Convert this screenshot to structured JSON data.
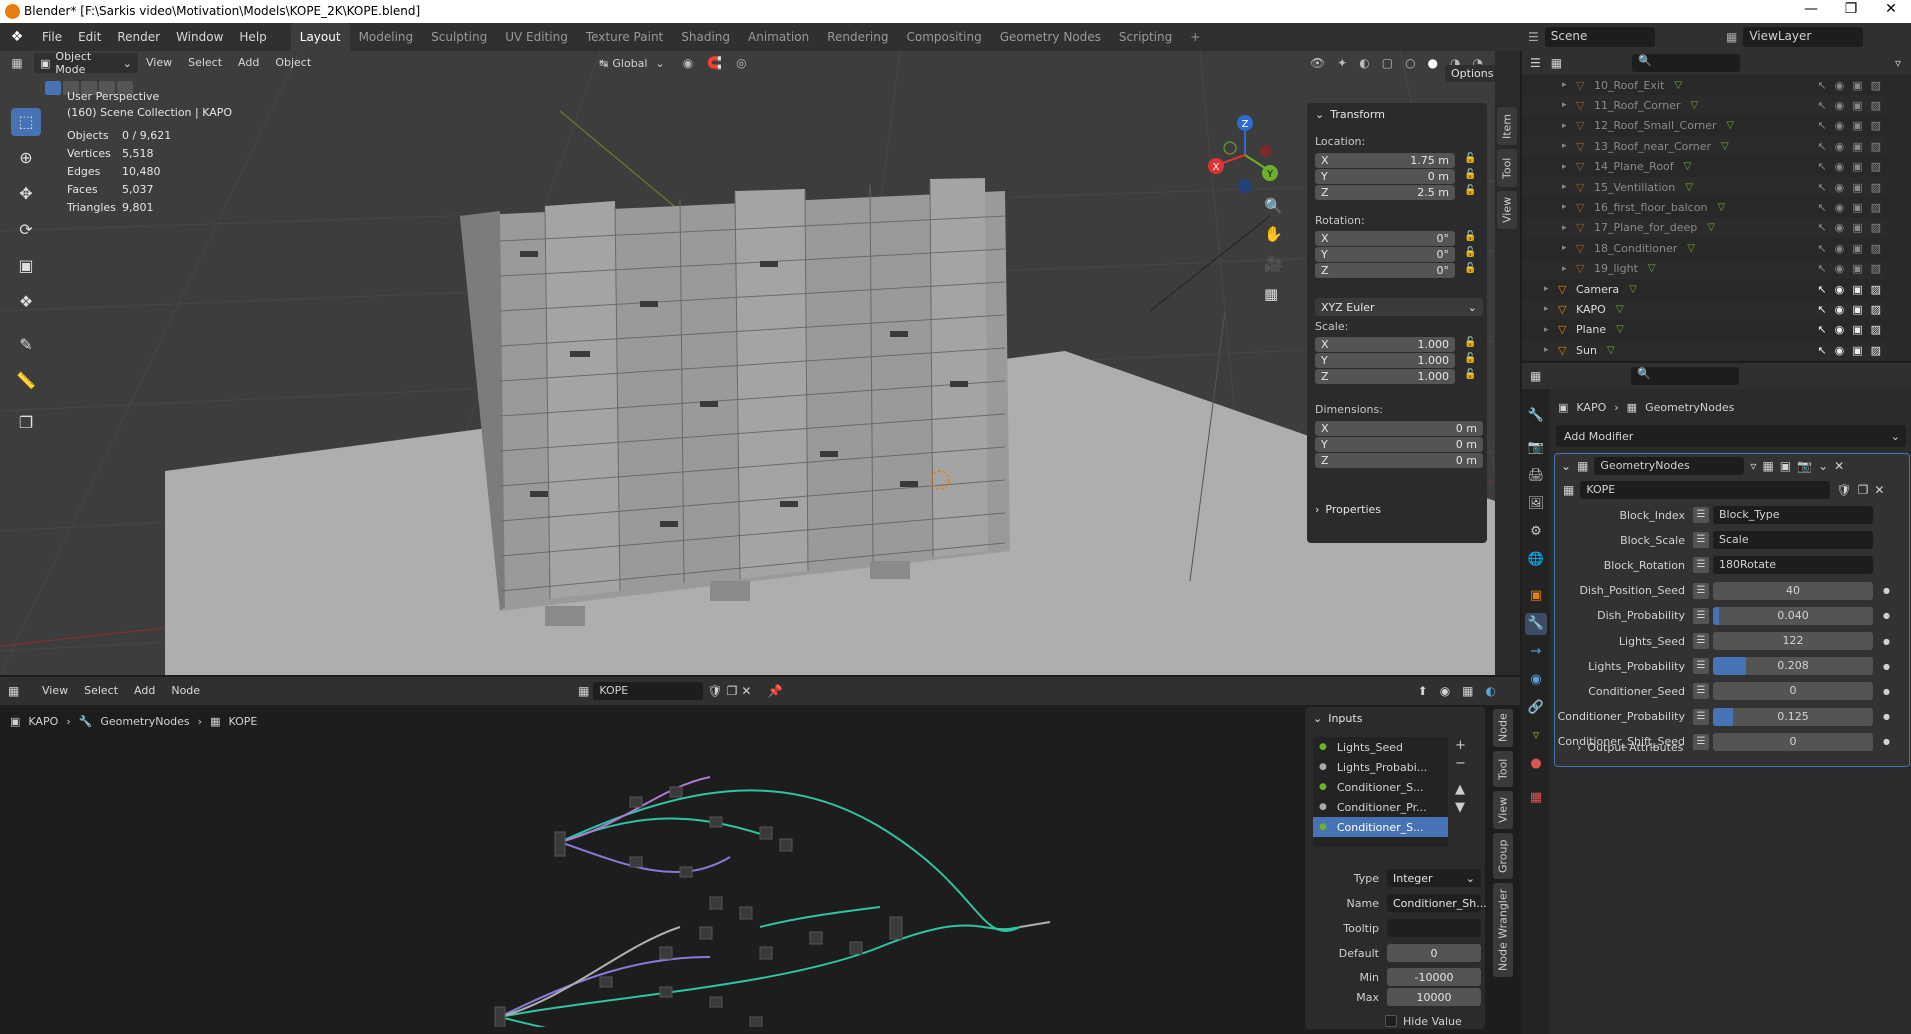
{
  "title": "Blender* [F:\\Sarkis video\\Motivation\\Models\\KOPE_2K\\KOPE.blend]",
  "window_controls": [
    "—",
    "❐",
    "✕"
  ],
  "menu": [
    "File",
    "Edit",
    "Render",
    "Window",
    "Help"
  ],
  "workspaces": [
    "Layout",
    "Modeling",
    "Sculpting",
    "UV Editing",
    "Texture Paint",
    "Shading",
    "Animation",
    "Rendering",
    "Compositing",
    "Geometry Nodes",
    "Scripting"
  ],
  "active_workspace": "Layout",
  "add_workspace": "+",
  "scene": "Scene",
  "view_layer": "ViewLayer",
  "viewport": {
    "mode": "Object Mode",
    "menu": [
      "View",
      "Select",
      "Add",
      "Object"
    ],
    "orientation": "Global",
    "options": "Options",
    "info_line1": "User Perspective",
    "info_line2": "(160) Scene Collection | KAPO",
    "stats": [
      {
        "label": "Objects",
        "value": "0 / 9,621"
      },
      {
        "label": "Vertices",
        "value": "5,518"
      },
      {
        "label": "Edges",
        "value": "10,480"
      },
      {
        "label": "Faces",
        "value": "5,037"
      },
      {
        "label": "Triangles",
        "value": "9,801"
      }
    ],
    "gizmo": {
      "z": "Z",
      "y": "Y",
      "x": "X"
    }
  },
  "sidebar_tabs": [
    "Item",
    "Tool",
    "View"
  ],
  "transform": {
    "title": "Transform",
    "location_label": "Location:",
    "location": [
      {
        "axis": "X",
        "value": "1.75 m"
      },
      {
        "axis": "Y",
        "value": "0 m"
      },
      {
        "axis": "Z",
        "value": "2.5 m"
      }
    ],
    "rotation_label": "Rotation:",
    "rotation": [
      {
        "axis": "X",
        "value": "0°"
      },
      {
        "axis": "Y",
        "value": "0°"
      },
      {
        "axis": "Z",
        "value": "0°"
      }
    ],
    "rotation_mode": "XYZ Euler",
    "scale_label": "Scale:",
    "scale": [
      {
        "axis": "X",
        "value": "1.000"
      },
      {
        "axis": "Y",
        "value": "1.000"
      },
      {
        "axis": "Z",
        "value": "1.000"
      }
    ],
    "dimensions_label": "Dimensions:",
    "dimensions": [
      {
        "axis": "X",
        "value": "0 m"
      },
      {
        "axis": "Y",
        "value": "0 m"
      },
      {
        "axis": "Z",
        "value": "0 m"
      }
    ],
    "properties": "Properties"
  },
  "outliner": {
    "items": [
      {
        "name": "10_Roof_Exit",
        "indent": 2,
        "dim": true
      },
      {
        "name": "11_Roof_Corner",
        "indent": 2,
        "dim": true
      },
      {
        "name": "12_Roof_Small_Corner",
        "indent": 2,
        "dim": true
      },
      {
        "name": "13_Roof_near_Corner",
        "indent": 2,
        "dim": true
      },
      {
        "name": "14_Plane_Roof",
        "indent": 2,
        "dim": true
      },
      {
        "name": "15_Ventillation",
        "indent": 2,
        "dim": true
      },
      {
        "name": "16_first_floor_balcon",
        "indent": 2,
        "dim": true
      },
      {
        "name": "17_Plane_for_deep",
        "indent": 2,
        "dim": true
      },
      {
        "name": "18_Conditioner",
        "indent": 2,
        "dim": true
      },
      {
        "name": "19_light",
        "indent": 2,
        "dim": true
      },
      {
        "name": "Camera",
        "indent": 1,
        "dim": false
      },
      {
        "name": "KAPO",
        "indent": 1,
        "dim": false
      },
      {
        "name": "Plane",
        "indent": 1,
        "dim": false
      },
      {
        "name": "Sun",
        "indent": 1,
        "dim": false
      }
    ]
  },
  "properties_panel": {
    "breadcrumb": [
      "KAPO",
      "GeometryNodes"
    ],
    "add_modifier": "Add Modifier",
    "modifier_name": "GeometryNodes",
    "node_group": "KOPE",
    "inputs": [
      {
        "label": "Block_Index",
        "value": "Block_Type",
        "kind": "attr"
      },
      {
        "label": "Block_Scale",
        "value": "Scale",
        "kind": "attr"
      },
      {
        "label": "Block_Rotation",
        "value": "180Rotate",
        "kind": "attr"
      },
      {
        "label": "Dish_Position_Seed",
        "value": "40",
        "kind": "num",
        "fill": 0
      },
      {
        "label": "Dish_Probability",
        "value": "0.040",
        "kind": "num",
        "fill": 0.04
      },
      {
        "label": "Lights_Seed",
        "value": "122",
        "kind": "num",
        "fill": 0
      },
      {
        "label": "Lights_Probability",
        "value": "0.208",
        "kind": "num",
        "fill": 0.208
      },
      {
        "label": "Conditioner_Seed",
        "value": "0",
        "kind": "num",
        "fill": 0
      },
      {
        "label": "Conditioner_Probability",
        "value": "0.125",
        "kind": "num",
        "fill": 0.125
      },
      {
        "label": "Conditioner_Shift_Seed",
        "value": "0",
        "kind": "num",
        "fill": 0
      }
    ],
    "output_attributes": "Output Attributes"
  },
  "node_editor": {
    "menu": [
      "View",
      "Select",
      "Add",
      "Node"
    ],
    "node_tree": "KOPE",
    "breadcrumb": [
      "KAPO",
      "GeometryNodes",
      "KOPE"
    ],
    "side_tabs": [
      "Node",
      "Tool",
      "View",
      "Group",
      "Node Wrangler"
    ],
    "inputs_title": "Inputs",
    "inputs": [
      "Lights_Seed",
      "Lights_Probabi...",
      "Conditioner_S...",
      "Conditioner_Pr...",
      "Conditioner_S..."
    ],
    "type_label": "Type",
    "type_value": "Integer",
    "name_label": "Name",
    "name_value": "Conditioner_Sh...",
    "tooltip_label": "Tooltip",
    "tooltip_value": "",
    "default_label": "Default",
    "default_value": "0",
    "min_label": "Min",
    "min_value": "-10000",
    "max_label": "Max",
    "max_value": "10000",
    "hide_value": "Hide Value"
  }
}
